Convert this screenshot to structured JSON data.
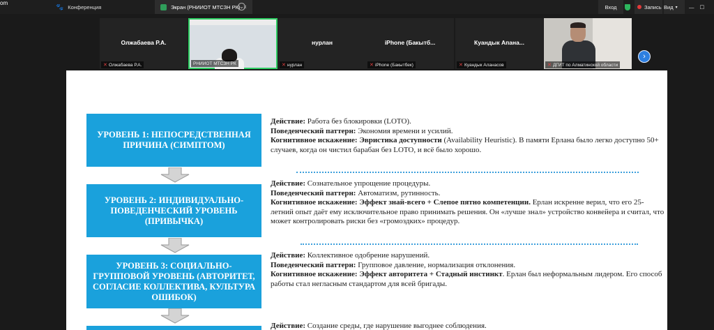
{
  "app": {
    "brand_line1": "om",
    "brand_line2": "rkplace",
    "tabs": [
      {
        "label": "Конференция"
      },
      {
        "label": "Экран (РНИИОТ МТСЗН РК)"
      }
    ],
    "right": {
      "login": "Вход",
      "record": "Запись",
      "view": "Вид"
    }
  },
  "participants": [
    {
      "name": "Олжабаева Р.А.",
      "label": "Олжабаева Р.А."
    },
    {
      "name": "",
      "label": "РНИИОТ МТСЗН РК"
    },
    {
      "name": "нурлан",
      "label": "нурлан"
    },
    {
      "name": "iPhone  (Бакытб...",
      "label": "iPhone (Бакытбек)"
    },
    {
      "name": "Куандык  Апана...",
      "label": "Куандык Аланасов"
    },
    {
      "name": "",
      "label": "ДГИТ по Алматинской области"
    }
  ],
  "slide": {
    "levels": [
      "УРОВЕНЬ 1: НЕПОСРЕДСТВЕННАЯ ПРИЧИНА (СИМПТОМ)",
      "УРОВЕНЬ 2: ИНДИВИДУАЛЬНО-ПОВЕДЕНЧЕСКИЙ УРОВЕНЬ (ПРИВЫЧКА)",
      "УРОВЕНЬ 3: СОЦИАЛЬНО-ГРУППОВОЙ УРОВЕНЬ (АВТОРИТЕТ, СОГЛАСИЕ КОЛЛЕКТИВА, КУЛЬТУРА ОШИБОК)",
      ""
    ],
    "blocks": [
      {
        "action_label": "Действие:",
        "action": " Работа без блокировки (LOTO).",
        "pattern_label": "Поведенческий паттерн:",
        "pattern": " Экономия времени и усилий.",
        "bias_label": "Когнитивное искажение:",
        "bias_bold": " Эвристика доступности",
        "bias_rest": " (Availability Heuristic). В памяти Ерлана было легко доступно 50+ случаев, когда он чистил барабан без LOTO, и всё было хорошо."
      },
      {
        "action_label": "Действие:",
        "action": " Сознательное упрощение процедуры.",
        "pattern_label": "Поведенческий паттерн:",
        "pattern": " Автоматизм, рутинность.",
        "bias_label": "Когнитивное искажение:",
        "bias_bold": " Эффект знай-всего + Слепое пятно компетенции.",
        "bias_rest": " Ерлан искренне верил, что его 25-летний опыт даёт ему исключительное право принимать решения. Он «лучше знал» устройство конвейера и считал, что может контролировать риски без «громоздких» процедур."
      },
      {
        "action_label": "Действие:",
        "action": " Коллективное одобрение нарушений.",
        "pattern_label": "Поведенческий паттерн:",
        "pattern": " Групповое давление, нормализация отклонения.",
        "bias_label": "Когнитивное искажение:",
        "bias_bold": " Эффект авторитета  + Стадный инстинкт",
        "bias_rest": ". Ерлан был неформальным лидером. Его способ работы стал негласным стандартом для всей бригады."
      },
      {
        "action_label": "Действие:",
        "action": " Создание среды, где нарушение выгоднее соблюдения."
      }
    ]
  }
}
